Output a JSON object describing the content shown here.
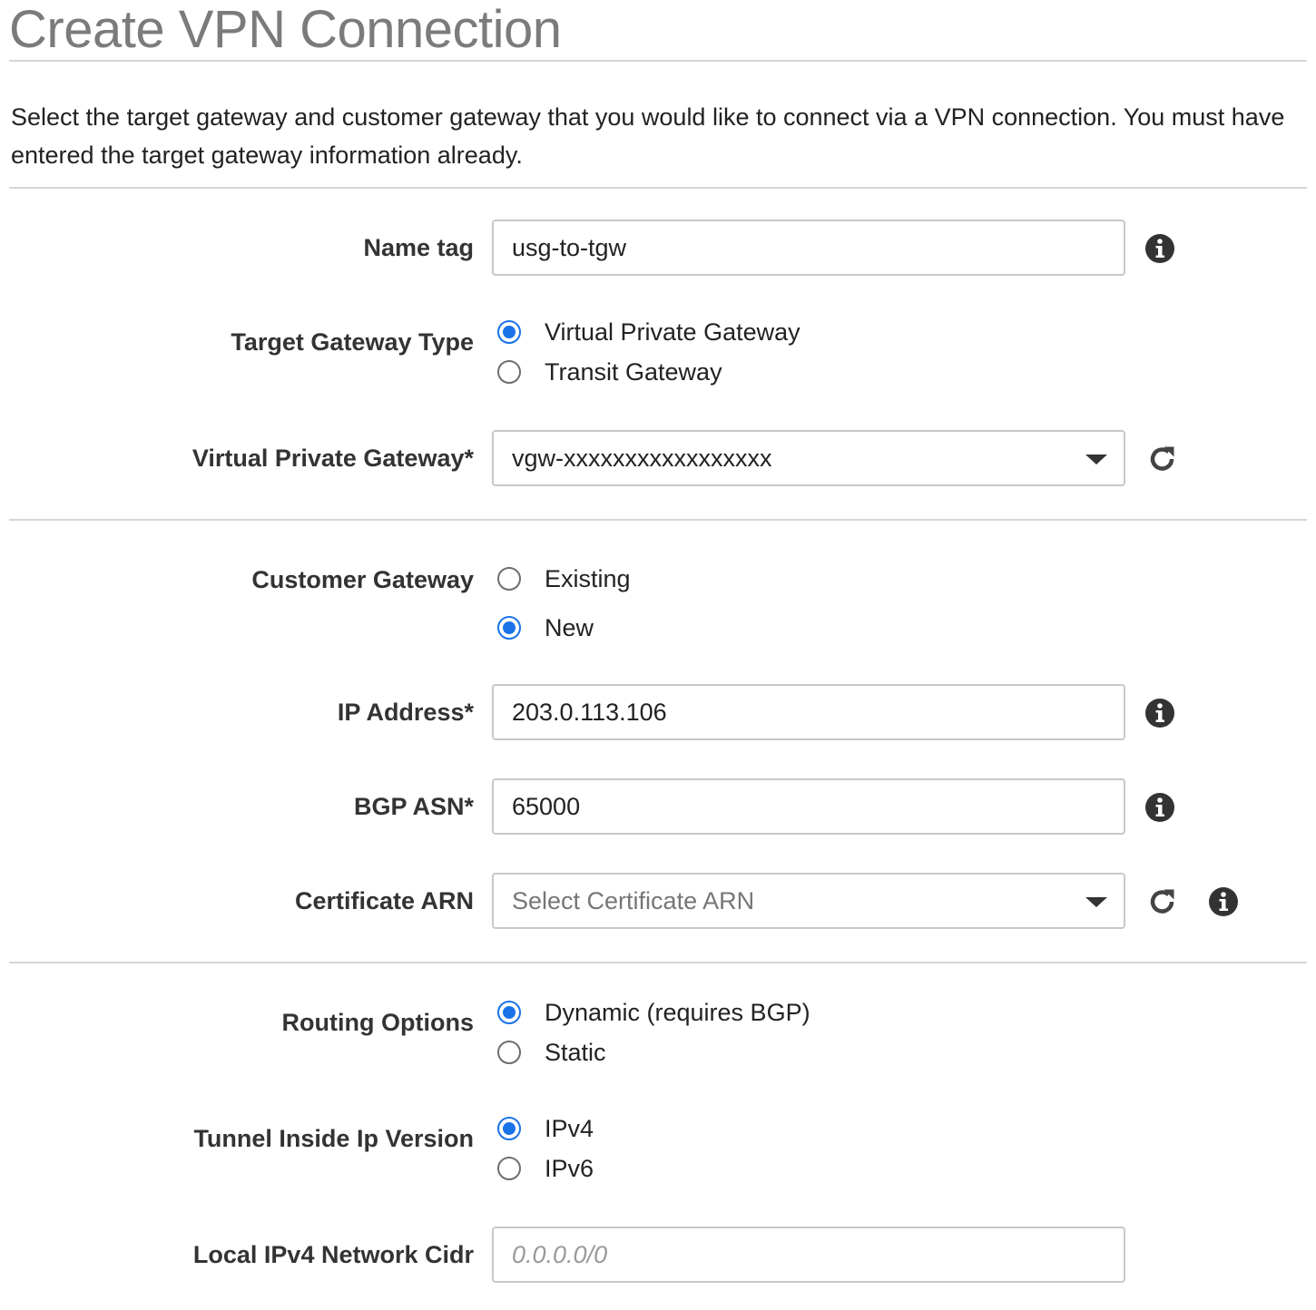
{
  "header": {
    "title": "Create VPN Connection",
    "description": "Select the target gateway and customer gateway that you would like to connect via a VPN connection. You must have entered the target gateway information already."
  },
  "form": {
    "name_tag": {
      "label": "Name tag",
      "value": "usg-to-tgw"
    },
    "target_gateway_type": {
      "label": "Target Gateway Type",
      "options": [
        "Virtual Private Gateway",
        "Transit Gateway"
      ],
      "selected": "Virtual Private Gateway"
    },
    "virtual_private_gateway": {
      "label": "Virtual Private Gateway*",
      "value": "vgw-xxxxxxxxxxxxxxxxx"
    },
    "customer_gateway": {
      "label": "Customer Gateway",
      "options": [
        "Existing",
        "New"
      ],
      "selected": "New"
    },
    "ip_address": {
      "label": "IP Address*",
      "value": "203.0.113.106"
    },
    "bgp_asn": {
      "label": "BGP ASN*",
      "value": "65000"
    },
    "certificate_arn": {
      "label": "Certificate ARN",
      "placeholder": "Select Certificate ARN"
    },
    "routing_options": {
      "label": "Routing Options",
      "options": [
        "Dynamic (requires BGP)",
        "Static"
      ],
      "selected": "Dynamic (requires BGP)"
    },
    "tunnel_inside_ip_version": {
      "label": "Tunnel Inside Ip Version",
      "options": [
        "IPv4",
        "IPv6"
      ],
      "selected": "IPv4"
    },
    "local_ipv4_network_cidr": {
      "label": "Local IPv4 Network Cidr",
      "placeholder": "0.0.0.0/0"
    }
  },
  "icons": {
    "info": "info-icon",
    "refresh": "refresh-icon",
    "dropdown": "chevron-down-icon"
  },
  "colors": {
    "accent": "#1a73e8",
    "title": "#7b7b7b",
    "border": "#c8c8c8"
  }
}
